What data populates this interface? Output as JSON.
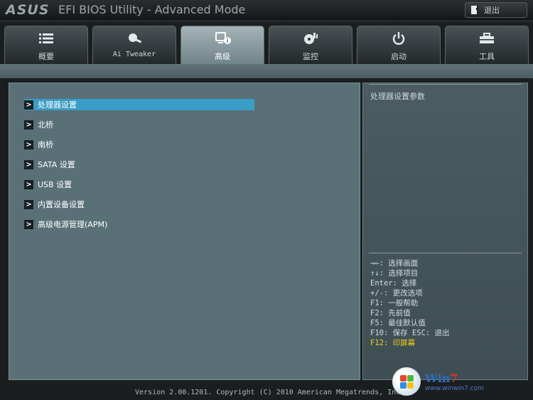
{
  "header": {
    "logo": "ASUS",
    "title": "EFI BIOS Utility - Advanced Mode",
    "exit_label": "退出",
    "exit_icon": "exit-door-icon"
  },
  "tabs": [
    {
      "label": "概要",
      "icon": "list-icon"
    },
    {
      "label": "Ai Tweaker",
      "icon": "tweaker-icon"
    },
    {
      "label": "高级",
      "icon": "advanced-info-icon",
      "active": true
    },
    {
      "label": "监控",
      "icon": "monitor-gauge-icon"
    },
    {
      "label": "启动",
      "icon": "power-icon"
    },
    {
      "label": "工具",
      "icon": "toolbox-icon"
    }
  ],
  "menu": {
    "items": [
      {
        "label": "处理器设置",
        "selected": true
      },
      {
        "label": "北桥"
      },
      {
        "label": "南桥"
      },
      {
        "label": "SATA 设置"
      },
      {
        "label": "USB 设置"
      },
      {
        "label": "内置设备设置"
      },
      {
        "label": "高级电源管理(APM)"
      }
    ]
  },
  "help": {
    "description": "处理器设置参数",
    "hints": [
      "→←: 选择画面",
      "↑↓: 选择项目",
      "Enter: 选择",
      "+/-: 更改选项",
      "F1: 一般帮助",
      "F2: 先前值",
      "F5: 最佳默认值",
      "F10: 保存  ESC: 退出",
      "F12: 印屏幕"
    ]
  },
  "footer": {
    "version": "Version 2.00.1201. Copyright (C) 2010 American Megatrends, Inc."
  },
  "watermark": {
    "brand": "Win",
    "brand_num": "7",
    "url": "www.winwin7.com"
  },
  "colors": {
    "selected_bg": "#3a9dc7",
    "panel_bg": "#5a7077",
    "highlight_hint": "#f4d020"
  }
}
